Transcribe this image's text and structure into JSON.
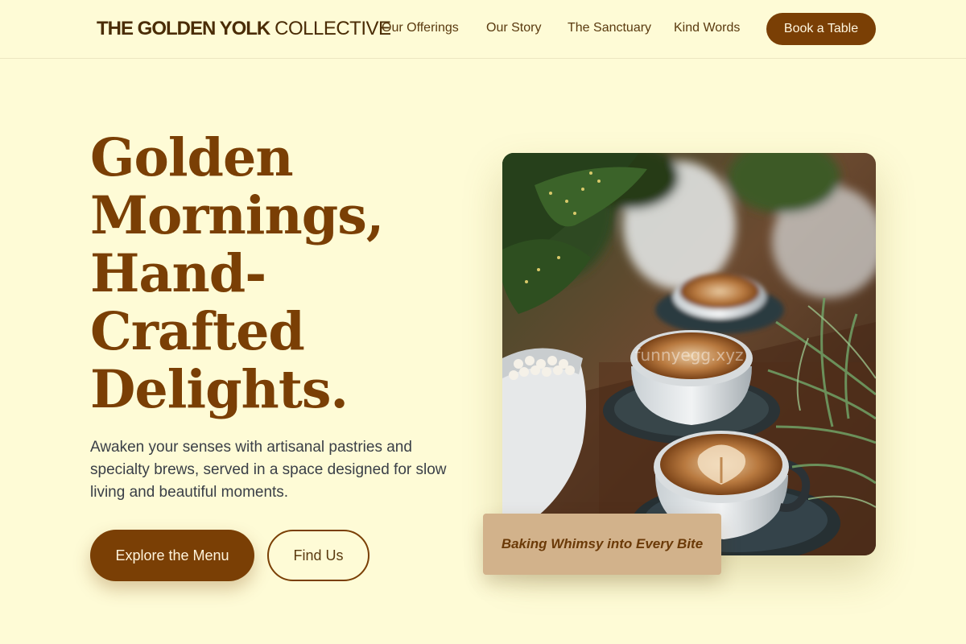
{
  "brand": {
    "name_bold": "THE GOLDEN YOLK",
    "name_light": "COLLECTIVE"
  },
  "nav": {
    "links": [
      {
        "label": "Our Offerings"
      },
      {
        "label": "Our Story"
      },
      {
        "label": "The Sanctuary"
      },
      {
        "label": "Kind Words"
      }
    ],
    "cta_label": "Book a Table"
  },
  "hero": {
    "headline_lines": [
      "Golden",
      "Mornings,",
      "Hand-",
      "Crafted",
      "Delights."
    ],
    "subtext": "Awaken your senses with artisanal pastries and specialty brews, served in a space designed for slow living and beautiful moments.",
    "primary_button": "Explore the Menu",
    "secondary_button": "Find Us"
  },
  "photo": {
    "caption": "Baking Whimsy into Every Bite",
    "watermark": "funnyegg.xyz"
  },
  "colors": {
    "background": "#fefbd6",
    "accent": "#7a3f05",
    "caption_card": "#d2b28b",
    "body_text": "#3a3f47"
  }
}
